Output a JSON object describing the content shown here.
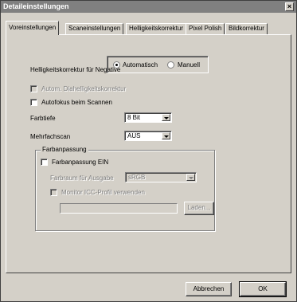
{
  "window": {
    "title": "Detaileinstellungen",
    "close_glyph": "×"
  },
  "tabs": [
    {
      "label": "Voreinstellungen"
    },
    {
      "label": "Scaneinstellungen"
    },
    {
      "label": "Helligkeitskorrektur"
    },
    {
      "label": "Pixel Polish"
    },
    {
      "label": "Bildkorrektur"
    }
  ],
  "negative": {
    "label": "Helligkeitskorrektur für Negative",
    "option_auto": "Automatisch",
    "option_manual": "Manuell",
    "selected": "Automatisch"
  },
  "checks": {
    "dia_label": "Autom. Diahelligkeitskorrektur",
    "autofocus_label": "Autofokus beim Scannen"
  },
  "farbtiefe": {
    "label": "Farbtiefe",
    "value": "8 Bit"
  },
  "mehrfachscan": {
    "label": "Mehrfachscan",
    "value": "AUS"
  },
  "farbanpassung": {
    "group_title": "Farbanpassung",
    "enable_label": "Farbanpassung EIN",
    "farbraum_label": "Farbraum für Ausgabe",
    "farbraum_value": "sRGB",
    "monitor_label": "Monitor ICC-Profil verwenden",
    "profile_path": "",
    "load_button": "Laden..."
  },
  "footer": {
    "cancel": "Abbrechen",
    "ok": "OK"
  }
}
